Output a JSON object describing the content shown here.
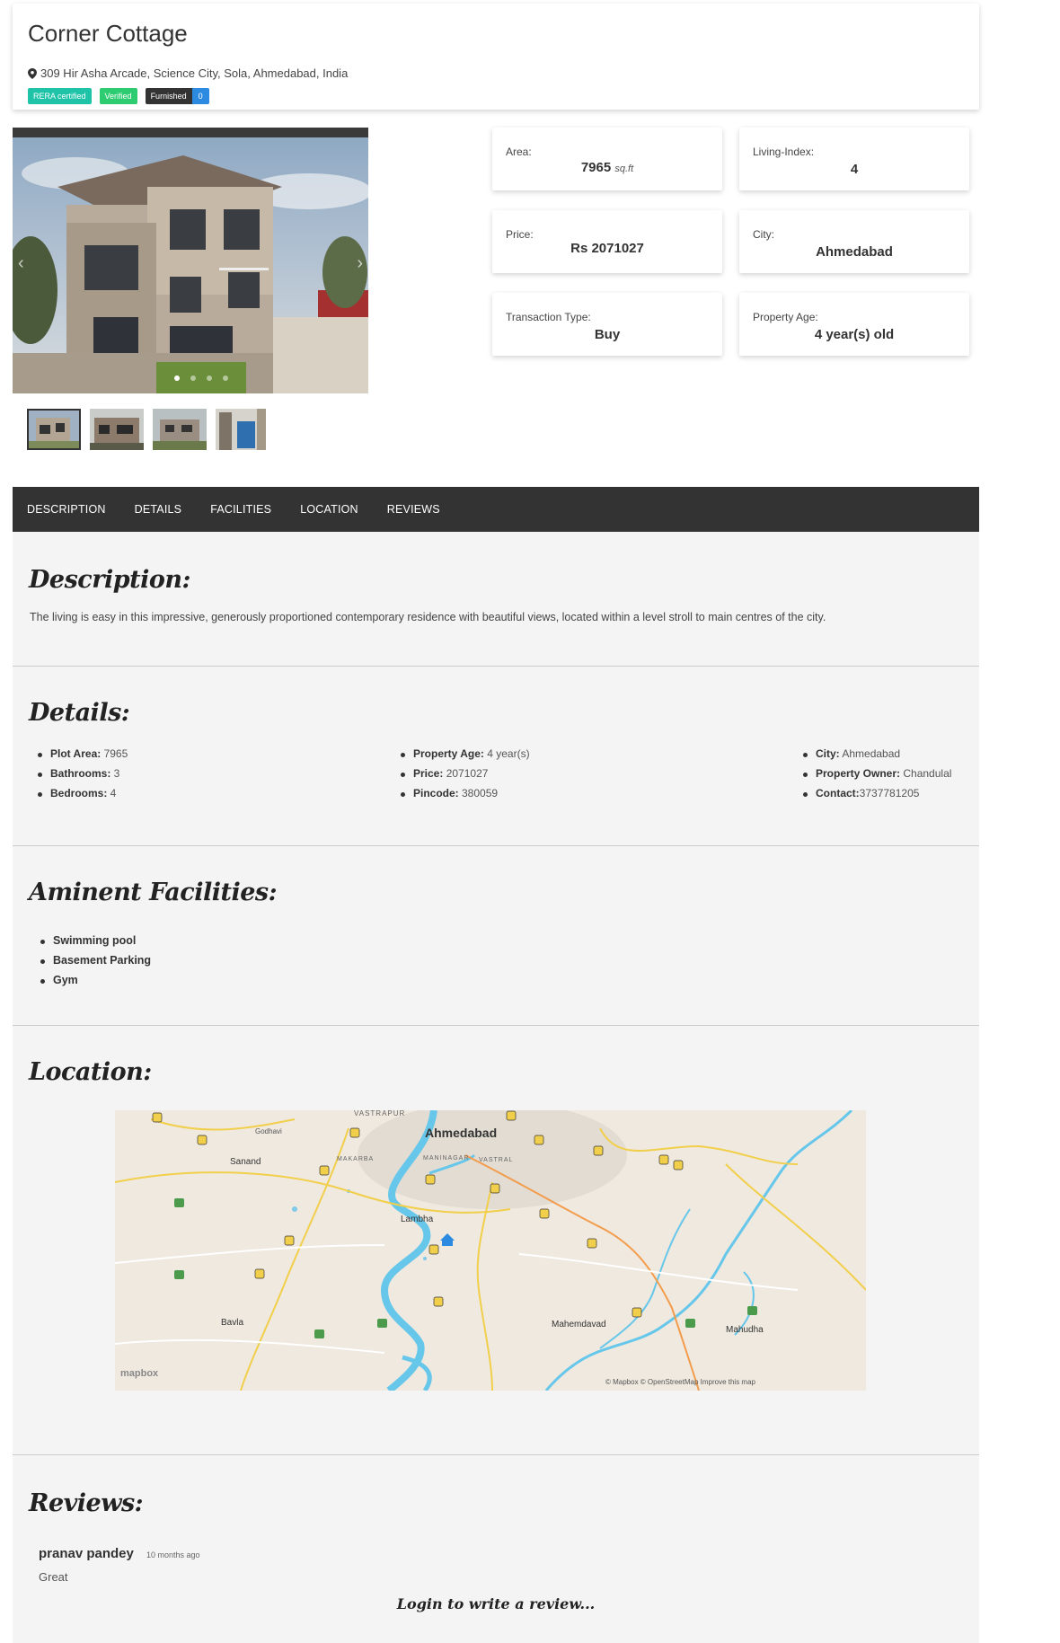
{
  "property": {
    "title": "Corner Cottage",
    "address": "309 Hir Asha Arcade, Science City, Sola, Ahmedabad, India",
    "badges": {
      "rera": "RERA certified",
      "verified": "Verified",
      "furnished": "Furnished",
      "furnished_count": "0"
    }
  },
  "info_cards": {
    "area": {
      "label": "Area:",
      "value": "7965",
      "unit": "sq.ft"
    },
    "living_index": {
      "label": "Living-Index:",
      "value": "4"
    },
    "price": {
      "label": "Price:",
      "value": "Rs 2071027"
    },
    "city": {
      "label": "City:",
      "value": "Ahmedabad"
    },
    "transaction": {
      "label": "Transaction Type:",
      "value": "Buy"
    },
    "age": {
      "label": "Property Age:",
      "value": "4 year(s) old"
    }
  },
  "tabs": [
    "DESCRIPTION",
    "DETAILS",
    "FACILITIES",
    "LOCATION",
    "REVIEWS"
  ],
  "description": {
    "title": "Description:",
    "text": "The living is easy in this impressive, generously proportioned contemporary residence with beautiful views, located within a level stroll to main centres of the city."
  },
  "details": {
    "title": "Details:",
    "col1": [
      {
        "key": "Plot Area:",
        "value": " 7965"
      },
      {
        "key": "Bathrooms:",
        "value": " 3"
      },
      {
        "key": "Bedrooms:",
        "value": " 4"
      }
    ],
    "col2": [
      {
        "key": "Property Age:",
        "value": " 4 year(s)"
      },
      {
        "key": "Price:",
        "value": " 2071027"
      },
      {
        "key": "Pincode:",
        "value": " 380059"
      }
    ],
    "col3": [
      {
        "key": "City:",
        "value": " Ahmedabad"
      },
      {
        "key": "Property Owner:",
        "value": " Chandulal"
      },
      {
        "key": "Contact:",
        "value": "3737781205"
      }
    ]
  },
  "facilities": {
    "title": "Aminent Facilities:",
    "items": [
      "Swimming pool",
      "Basement Parking",
      "Gym"
    ]
  },
  "location": {
    "title": "Location:",
    "map_labels": {
      "city": "Ahmedabad",
      "vastrapur": "VASTRAPUR",
      "godhavi": "Godhavi",
      "sanand": "Sanand",
      "makarba": "MAKARBA",
      "maninagar": "MANINAGAR",
      "vastral": "VASTRAL",
      "lambha": "Lambha",
      "bavla": "Bavla",
      "mahemdavad": "Mahemdavad",
      "mahudha": "Mahudha",
      "logo": "mapbox",
      "attribution": "© Mapbox © OpenStreetMap Improve this map"
    }
  },
  "reviews": {
    "title": "Reviews:",
    "items": [
      {
        "name": "pranav pandey",
        "time": "10 months ago",
        "text": "Great"
      }
    ],
    "login_prompt": "Login to write a review..."
  }
}
